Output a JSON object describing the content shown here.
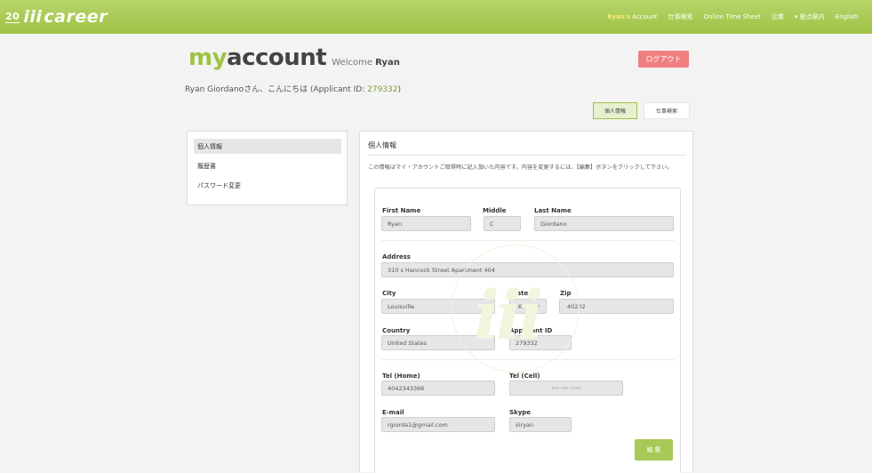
{
  "header": {
    "logo_badge": "20",
    "logo_iii": "iii",
    "logo_text": "career",
    "nav": {
      "account_name": "Ryan's",
      "account_label": " Account",
      "job_search": "仕事検索",
      "time_sheet": "Online Time Sheet",
      "company": "企業",
      "locations": "▾ 拠点案内",
      "english": "English"
    }
  },
  "account": {
    "brand_my": "my",
    "brand_account": "account",
    "welcome_label": "Welcome",
    "welcome_name": "Ryan",
    "logout_label": "ログアウト",
    "greeting": "Ryan Giordanoさん、こんにちは (Applicant ID: ",
    "applicant_id": "279332",
    "greeting_end": ")",
    "tab_personal": "個人情報",
    "tab_job_search": "仕事検索"
  },
  "sidebar": {
    "items": [
      {
        "label": "個人情報",
        "active": true
      },
      {
        "label": "履歴書",
        "active": false
      },
      {
        "label": "パスワード変更",
        "active": false
      }
    ]
  },
  "main": {
    "title": "個人情報",
    "description": "この情報はマイ・アカウントご取得時に記入頂いた内容です。内容を変更するには、【編集】ボタンをクリックして下さい。",
    "watermark": "iii",
    "form": {
      "first_name_label": "First Name",
      "first_name": "Ryan",
      "middle_label": "Middle",
      "middle": "C",
      "last_name_label": "Last Name",
      "last_name": "Giordano",
      "address_label": "Address",
      "address": "310 s Hancock Street Apartment 404",
      "city_label": "City",
      "city": "Louisville",
      "state_label": "State",
      "state": "KY",
      "zip_label": "Zip",
      "zip": "40202",
      "country_label": "Country",
      "country": "United States",
      "applicant_id_label": "Applicant ID",
      "applicant_id": "279332",
      "tel_home_label": "Tel (Home)",
      "tel_home": "4042343366",
      "tel_cell_label": "Tel (Cell)",
      "tel_cell_placeholder": "xxx-xxx-xxxx",
      "email_label": "E-mail",
      "email": "rgiorda1@gmail.com",
      "skype_label": "Skype",
      "skype": "iiiryan",
      "edit_label": "編 集"
    }
  },
  "colors": {
    "brand_green": "#9ec245",
    "logout_red": "#f08080"
  }
}
